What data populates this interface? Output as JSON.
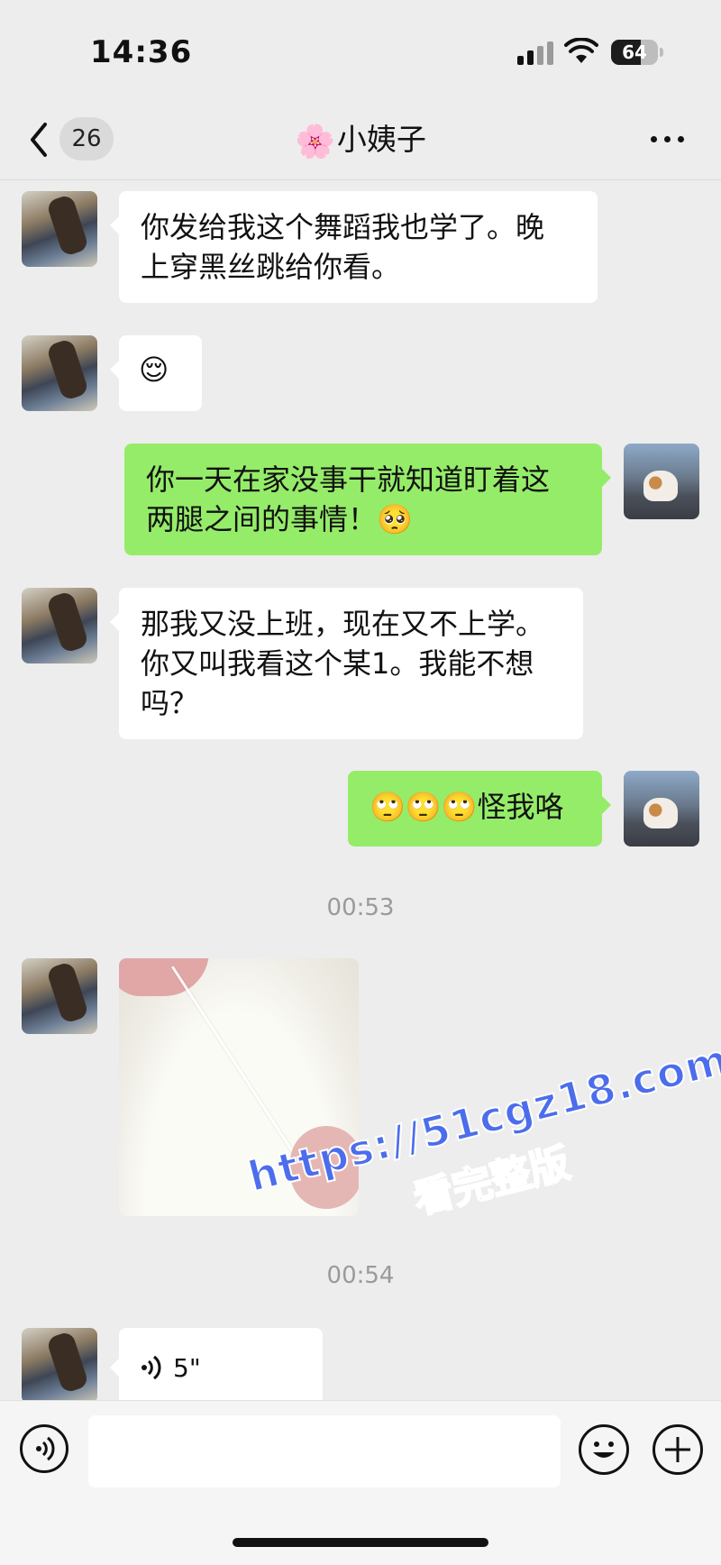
{
  "status_bar": {
    "time": "14:36",
    "battery_level": "64",
    "battery_fraction": 0.64,
    "icons": [
      "cellular-signal-icon",
      "wifi-icon",
      "battery-icon"
    ]
  },
  "nav": {
    "back_icon": "chevron-left-icon",
    "unread_count": "26",
    "title_prefix": "🌸",
    "title": "小姨子",
    "more_icon": "more-dots-icon"
  },
  "messages": [
    {
      "from": "other",
      "type": "text",
      "text_lines": [
        "你发给我这个舞蹈我也学了。晚",
        "上穿黑丝跳给你看。"
      ]
    },
    {
      "from": "other",
      "type": "emoji",
      "text": "😌"
    },
    {
      "from": "self",
      "type": "text",
      "text_lines": [
        "你一天在家没事干就知道盯着这",
        "两腿之间的事情！🥺"
      ]
    },
    {
      "from": "other",
      "type": "text",
      "text_lines": [
        "那我又没上班，现在又不上学。",
        "你又叫我看这个某1。我能不想",
        "吗？"
      ]
    },
    {
      "from": "self",
      "type": "text",
      "text": "🙄🙄🙄怪我咯"
    },
    {
      "type": "timestamp",
      "text": "00:53"
    },
    {
      "from": "other",
      "type": "image",
      "icon": "photo-thumbnail"
    },
    {
      "type": "timestamp",
      "text": "00:54"
    },
    {
      "from": "other",
      "type": "voice",
      "duration": "5\"",
      "icon": "voice-wave-icon"
    }
  ],
  "watermark": {
    "url": "https://51cgz18.com",
    "subtitle": "看完整版"
  },
  "input_bar": {
    "voice_icon": "voice-mode-icon",
    "input_value": "",
    "emoji_icon": "smiley-icon",
    "plus_icon": "plus-icon"
  },
  "colors": {
    "background": "#ededed",
    "self_bubble": "#95ec69",
    "other_bubble": "#ffffff",
    "timestamp_text": "#9a9a9a",
    "watermark": "#4c6dec"
  }
}
